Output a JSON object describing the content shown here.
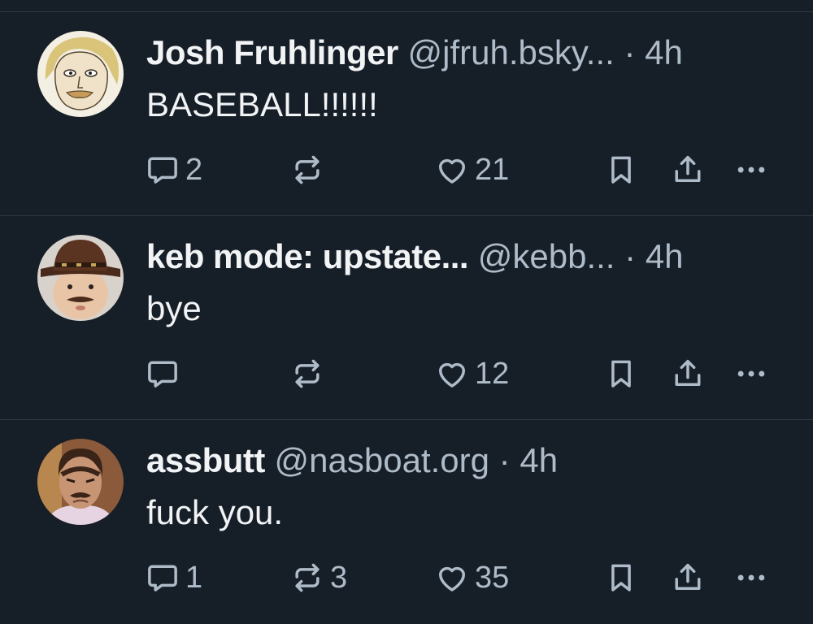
{
  "posts": [
    {
      "display_name": "Josh Fruhlinger",
      "handle": "@jfruh.bsky...",
      "separator": "·",
      "time": "4h",
      "text": "BASEBALL!!!!!!",
      "reply_count": "2",
      "repost_count": "",
      "like_count": "21"
    },
    {
      "display_name": "keb mode: upstate...",
      "handle": "@kebb...",
      "separator": "·",
      "time": "4h",
      "text": "bye",
      "reply_count": "",
      "repost_count": "",
      "like_count": "12"
    },
    {
      "display_name": "assbutt",
      "handle": "@nasboat.org",
      "separator": "·",
      "time": "4h",
      "text": "fuck you.",
      "reply_count": "1",
      "repost_count": "3",
      "like_count": "35"
    }
  ],
  "icons": {
    "reply": "reply-icon",
    "repost": "repost-icon",
    "like": "heart-icon",
    "bookmark": "bookmark-icon",
    "share": "share-icon",
    "more": "more-icon"
  },
  "colors": {
    "background": "#161e27",
    "divider": "#2e3a47",
    "primary_text": "#f1f3f5",
    "secondary_text": "#aebbc9"
  }
}
